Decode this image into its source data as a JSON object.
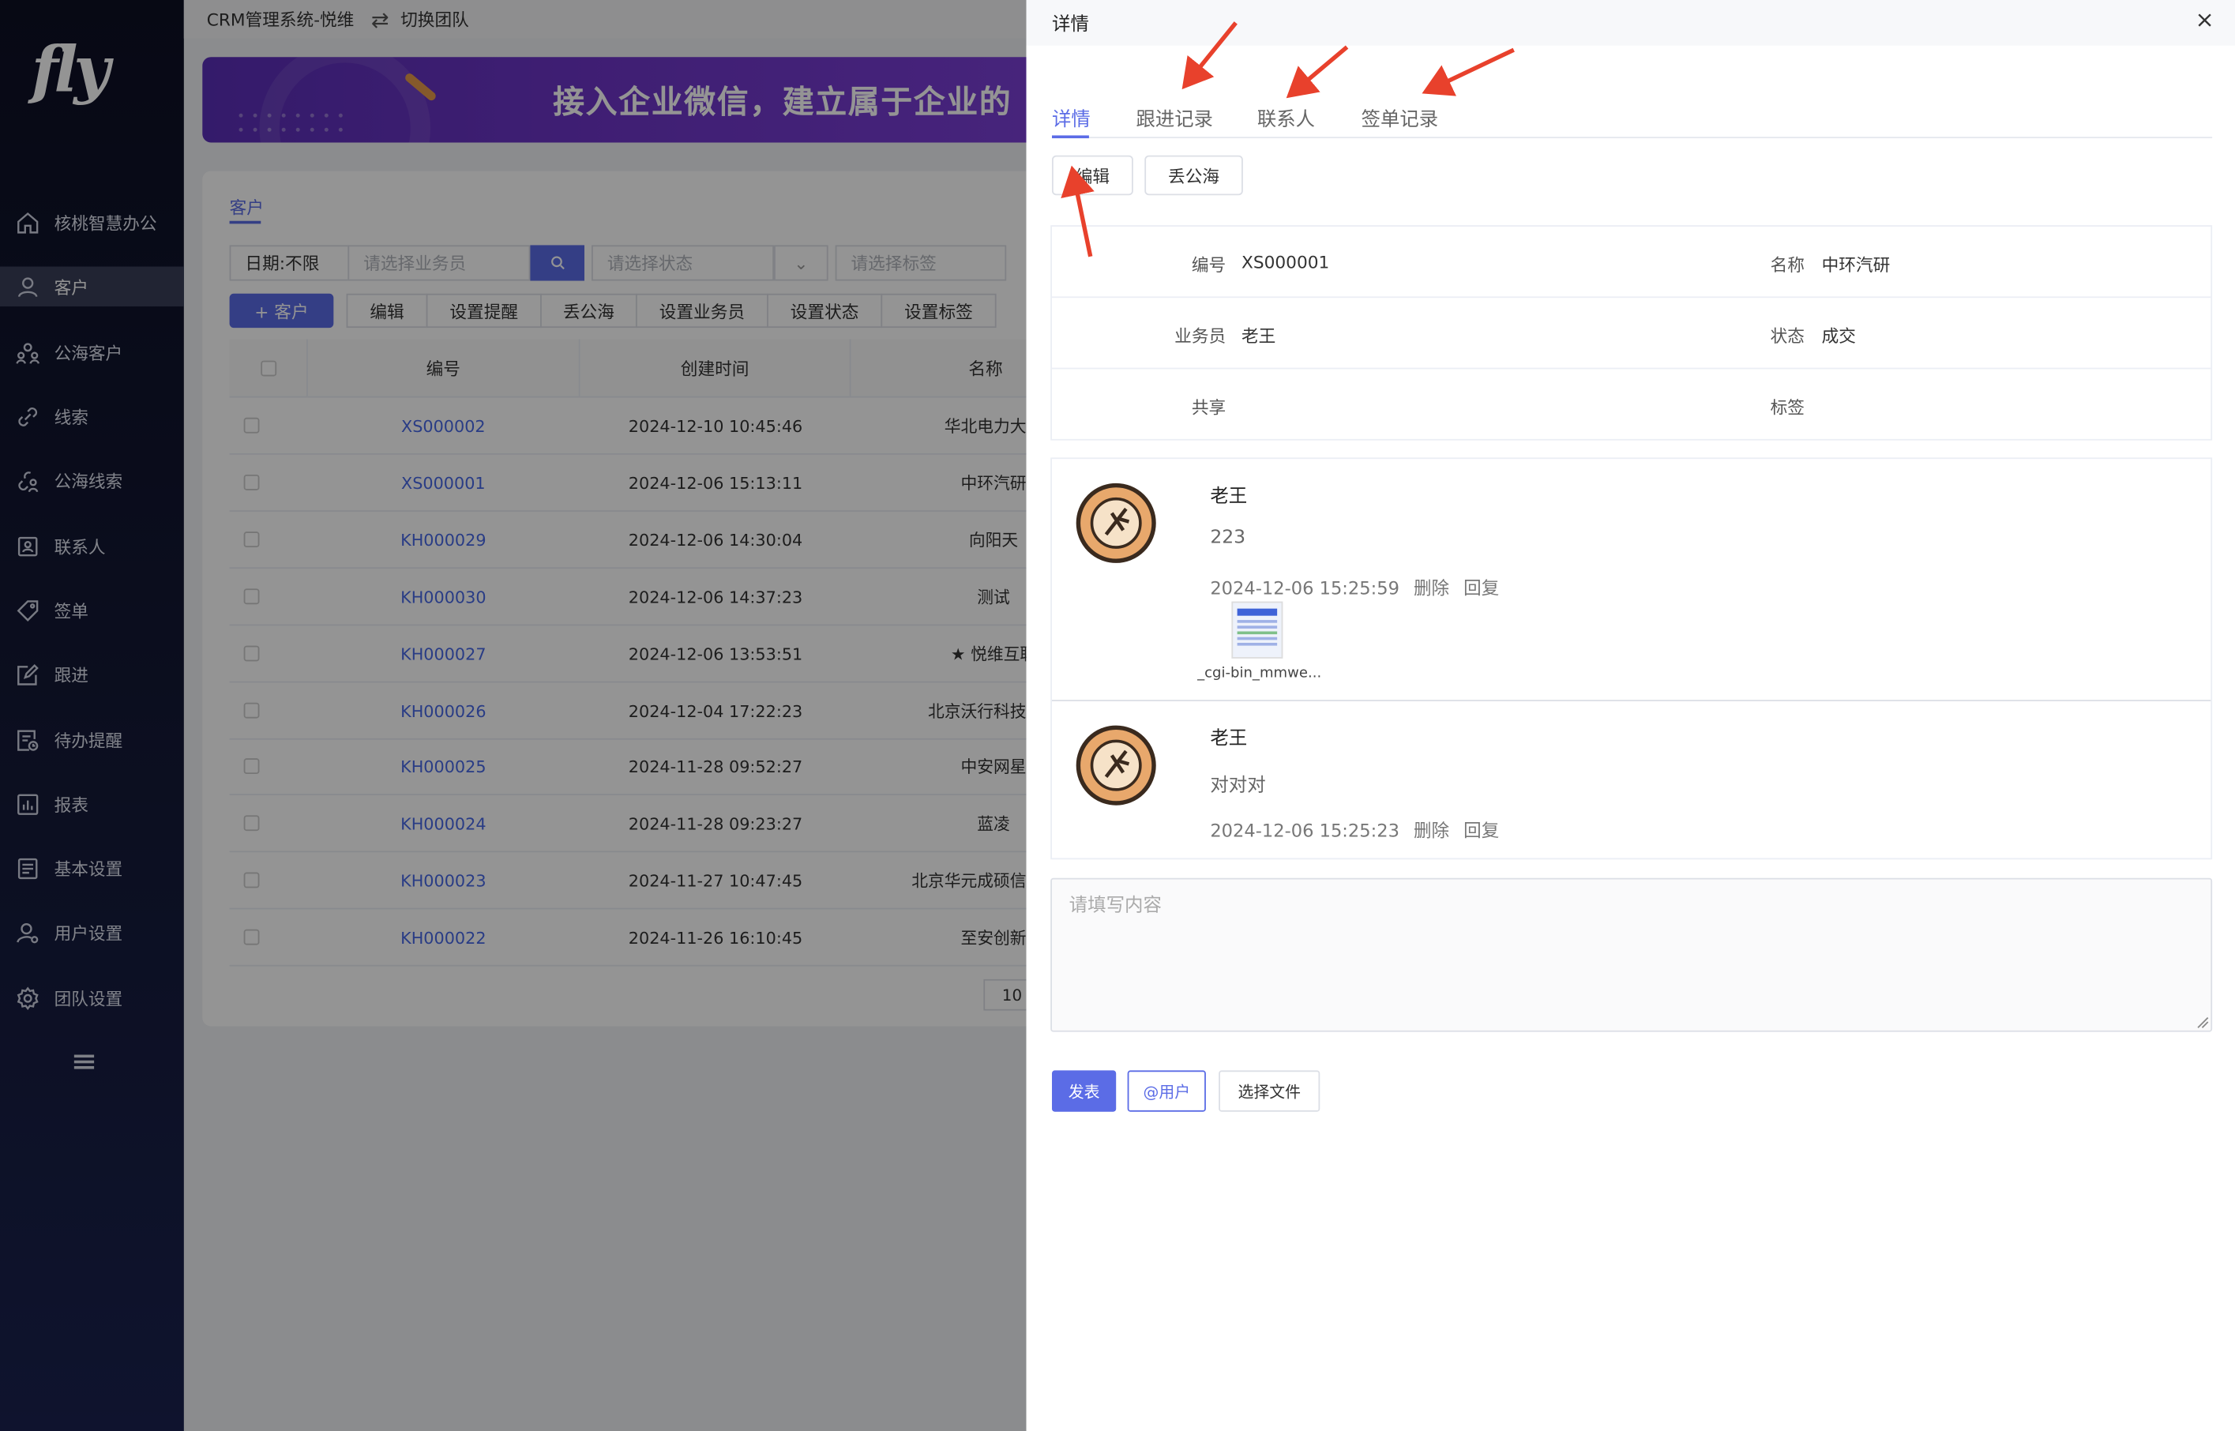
{
  "sidebar": {
    "logo": "fly",
    "items": [
      {
        "label": "核桃智慧办公",
        "icon": "home-icon"
      },
      {
        "label": "客户",
        "icon": "user-icon"
      },
      {
        "label": "公海客户",
        "icon": "group-icon"
      },
      {
        "label": "线索",
        "icon": "link-icon"
      },
      {
        "label": "公海线索",
        "icon": "link-user-icon"
      },
      {
        "label": "联系人",
        "icon": "contact-card-icon"
      },
      {
        "label": "签单",
        "icon": "tag-icon"
      },
      {
        "label": "跟进",
        "icon": "edit-icon"
      },
      {
        "label": "待办提醒",
        "icon": "reminder-icon"
      },
      {
        "label": "报表",
        "icon": "chart-icon"
      },
      {
        "label": "基本设置",
        "icon": "settings-list-icon"
      },
      {
        "label": "用户设置",
        "icon": "user-settings-icon"
      },
      {
        "label": "团队设置",
        "icon": "gear-icon"
      }
    ]
  },
  "topbar": {
    "system_name": "CRM管理系统-悦维",
    "switch_team": "切换团队"
  },
  "banner": {
    "text": "接入企业微信，建立属于企业的"
  },
  "customers": {
    "tab": "客户",
    "filters": {
      "date": "日期:不限",
      "salesman_placeholder": "请选择业务员",
      "status_placeholder": "请选择状态",
      "tag_placeholder": "请选择标签"
    },
    "buttons": {
      "add": "+ 客户",
      "edit": "编辑",
      "set_reminder": "设置提醒",
      "to_pool": "丢公海",
      "set_salesman": "设置业务员",
      "set_status": "设置状态",
      "set_tag": "设置标签"
    },
    "columns": [
      "编号",
      "创建时间",
      "名称"
    ],
    "rows": [
      {
        "id": "XS000002",
        "created": "2024-12-10 10:45:46",
        "name": "华北电力大学"
      },
      {
        "id": "XS000001",
        "created": "2024-12-06 15:13:11",
        "name": "中环汽研"
      },
      {
        "id": "KH000029",
        "created": "2024-12-06 14:30:04",
        "name": "向阳天"
      },
      {
        "id": "KH000030",
        "created": "2024-12-06 14:37:23",
        "name": "测试"
      },
      {
        "id": "KH000027",
        "created": "2024-12-06 13:53:51",
        "name": "★ 悦维互联"
      },
      {
        "id": "KH000026",
        "created": "2024-12-04 17:22:23",
        "name": "北京沃行科技有限"
      },
      {
        "id": "KH000025",
        "created": "2024-11-28 09:52:27",
        "name": "中安网星"
      },
      {
        "id": "KH000024",
        "created": "2024-11-28 09:23:27",
        "name": "蓝凌"
      },
      {
        "id": "KH000023",
        "created": "2024-11-27 10:47:45",
        "name": "北京华元成硕信息技术"
      },
      {
        "id": "KH000022",
        "created": "2024-11-26 16:10:45",
        "name": "至安创新"
      }
    ],
    "page_size": "10"
  },
  "panel": {
    "title": "详情",
    "tabs": [
      "详情",
      "跟进记录",
      "联系人",
      "签单记录"
    ],
    "actions": {
      "edit": "编辑",
      "to_pool": "丢公海"
    },
    "info": {
      "id_label": "编号",
      "id_value": "XS000001",
      "name_label": "名称",
      "name_value": "中环汽研",
      "salesman_label": "业务员",
      "salesman_value": "老王",
      "status_label": "状态",
      "status_value": "成交",
      "share_label": "共享",
      "tag_label": "标签"
    },
    "comments": [
      {
        "author": "老王",
        "text": "223",
        "time": "2024-12-06 15:25:59",
        "delete": "删除",
        "reply": "回复",
        "attachment": "_cgi-bin_mmwe..."
      },
      {
        "author": "老王",
        "text": "对对对",
        "time": "2024-12-06 15:25:23",
        "delete": "删除",
        "reply": "回复"
      }
    ],
    "editor": {
      "placeholder": "请填写内容",
      "publish": "发表",
      "mention": "@用户",
      "choose_file": "选择文件"
    }
  },
  "colors": {
    "accent": "#5b6ce6",
    "annotation_arrow": "#e8412c",
    "sidebar_bg": "#0d1024"
  }
}
